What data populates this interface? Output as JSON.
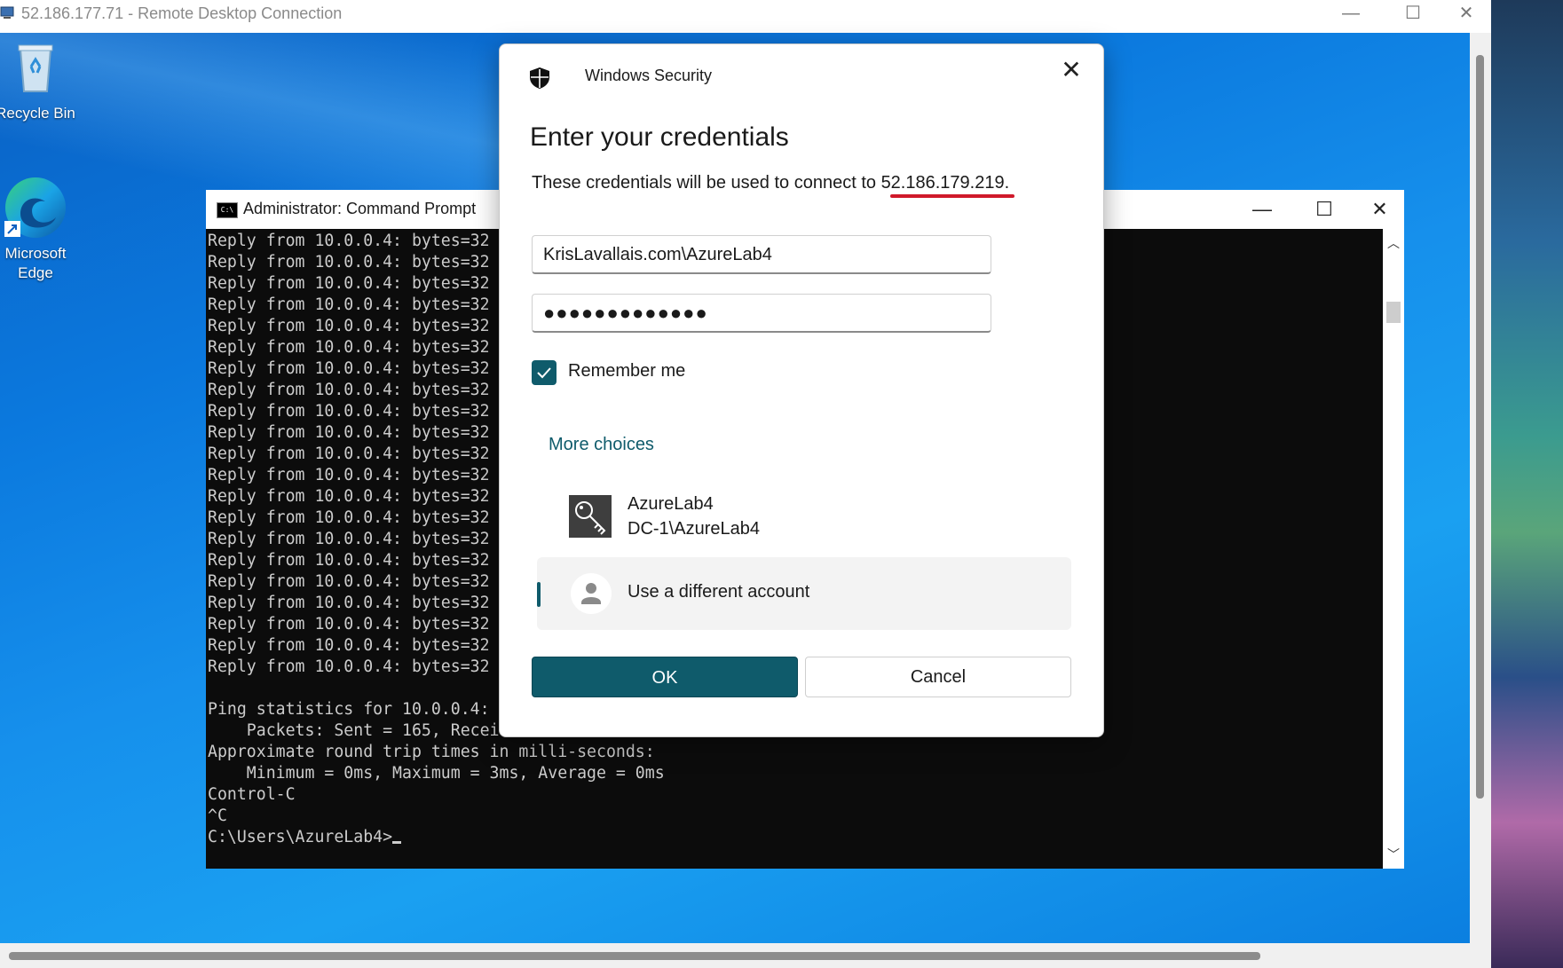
{
  "rdp": {
    "title": "52.186.177.71 - Remote Desktop Connection"
  },
  "desktop": {
    "icons": [
      {
        "label": "Recycle Bin"
      },
      {
        "label_line1": "Microsoft",
        "label_line2": "Edge"
      }
    ]
  },
  "cmd": {
    "title": "Administrator: Command Prompt",
    "lines": [
      "Reply from 10.0.0.4: bytes=32",
      "Reply from 10.0.0.4: bytes=32",
      "Reply from 10.0.0.4: bytes=32",
      "Reply from 10.0.0.4: bytes=32",
      "Reply from 10.0.0.4: bytes=32",
      "Reply from 10.0.0.4: bytes=32",
      "Reply from 10.0.0.4: bytes=32",
      "Reply from 10.0.0.4: bytes=32",
      "Reply from 10.0.0.4: bytes=32",
      "Reply from 10.0.0.4: bytes=32",
      "Reply from 10.0.0.4: bytes=32",
      "Reply from 10.0.0.4: bytes=32",
      "Reply from 10.0.0.4: bytes=32",
      "Reply from 10.0.0.4: bytes=32",
      "Reply from 10.0.0.4: bytes=32",
      "Reply from 10.0.0.4: bytes=32",
      "Reply from 10.0.0.4: bytes=32",
      "Reply from 10.0.0.4: bytes=32",
      "Reply from 10.0.0.4: bytes=32",
      "Reply from 10.0.0.4: bytes=32",
      "Reply from 10.0.0.4: bytes=32",
      "",
      "Ping statistics for 10.0.0.4:",
      "    Packets: Sent = 165, Recei",
      "Approximate round trip times in milli-seconds:",
      "    Minimum = 0ms, Maximum = 3ms, Average = 0ms",
      "Control-C",
      "^C",
      "C:\\Users\\AzureLab4>"
    ]
  },
  "dialog": {
    "app_name": "Windows Security",
    "heading": "Enter your credentials",
    "info_prefix": "These credentials will be used to connect to ",
    "target_ip": "52.186.179.219",
    "info_suffix": ".",
    "username_value": "KrisLavallais.com\\AzureLab4",
    "password_masked": "●●●●●●●●●●●●●",
    "remember_label": "Remember me",
    "remember_checked": true,
    "more_choices": "More choices",
    "account_name": "AzureLab4",
    "account_domain": "DC-1\\AzureLab4",
    "different_account": "Use a different account",
    "ok_label": "OK",
    "cancel_label": "Cancel"
  },
  "colors": {
    "accent": "#0f5b6b",
    "highlight_underline": "#d0192a",
    "desktop_blue": "#0b79de",
    "terminal_bg": "#0c0c0c",
    "terminal_text": "#cccccc"
  }
}
